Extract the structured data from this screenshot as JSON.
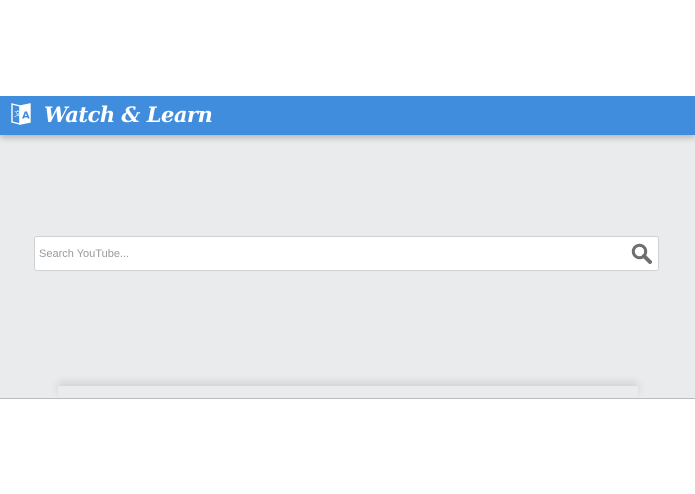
{
  "app": {
    "title": "Watch & Learn",
    "brand_color": "#418ddd",
    "background_color": "#e9ebec",
    "logo_icon": "translate-icon"
  },
  "search": {
    "placeholder": "Search YouTube...",
    "value": "",
    "button_icon": "search-icon"
  }
}
